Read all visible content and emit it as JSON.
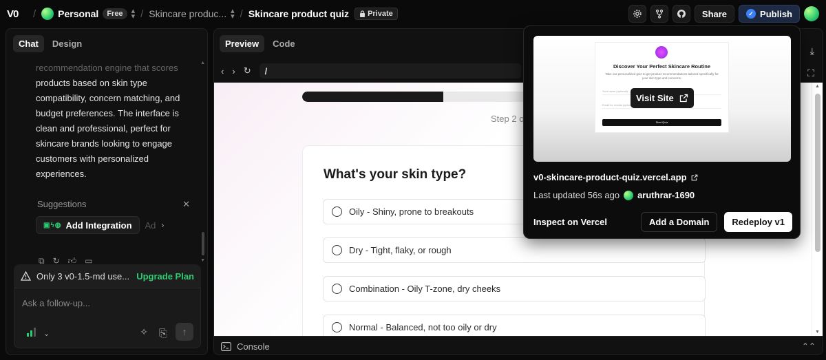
{
  "topbar": {
    "logo": "V0",
    "workspace": "Personal",
    "plan_badge": "Free",
    "project_crumb": "Skincare produc...",
    "chat_title": "Skincare product quiz",
    "visibility": "Private",
    "share_label": "Share",
    "publish_label": "Publish"
  },
  "left_panel": {
    "tabs": [
      {
        "label": "Chat"
      },
      {
        "label": "Design"
      }
    ],
    "chat_faded_line": "recommendation engine that scores",
    "chat_lines": [
      "products based on skin type",
      "compatibility, concern matching, and",
      "budget preferences. The interface is",
      "clean and professional, perfect for",
      "skincare brands looking to engage",
      "customers with personalized",
      "experiences."
    ],
    "suggestions_label": "Suggestions",
    "suggestion_chip": "Add Integration",
    "suggestion_chip_next": "Ad",
    "upgrade_notice": "Only 3 v0-1.5-md use...",
    "upgrade_link": "Upgrade Plan",
    "input_placeholder": "Ask a follow-up..."
  },
  "right_panel": {
    "tabs": [
      {
        "label": "Preview"
      },
      {
        "label": "Code"
      }
    ],
    "url_path": "/",
    "progress": 0.35,
    "step_text": "Step 2 o",
    "question": "What's your skin type?",
    "options": [
      {
        "label": "Oily - Shiny, prone to breakouts"
      },
      {
        "label": "Dry - Tight, flaky, or rough"
      },
      {
        "label": "Combination - Oily T-zone, dry cheeks"
      },
      {
        "label": "Normal - Balanced, not too oily or dry"
      }
    ],
    "console_label": "Console"
  },
  "popover": {
    "thumbnail": {
      "title": "Discover Your Perfect Skincare Routine",
      "subtitle": "Take our personalized quiz to get product recommendations tailored specifically for your skin type and concerns.",
      "field1": "Your name (optional)",
      "field2": "Email for results (optional)",
      "button": "Start Quiz"
    },
    "visit_label": "Visit Site",
    "site_url": "v0-skincare-product-quiz.vercel.app",
    "updated_text": "Last updated 56s ago",
    "username": "aruthrar-1690",
    "inspect_label": "Inspect on Vercel",
    "add_domain_label": "Add a Domain",
    "redeploy_label": "Redeploy v1"
  },
  "colors": {
    "accent_green": "#2ecc71",
    "publish_blue": "#3b82f6",
    "background": "#0a0a0a"
  }
}
